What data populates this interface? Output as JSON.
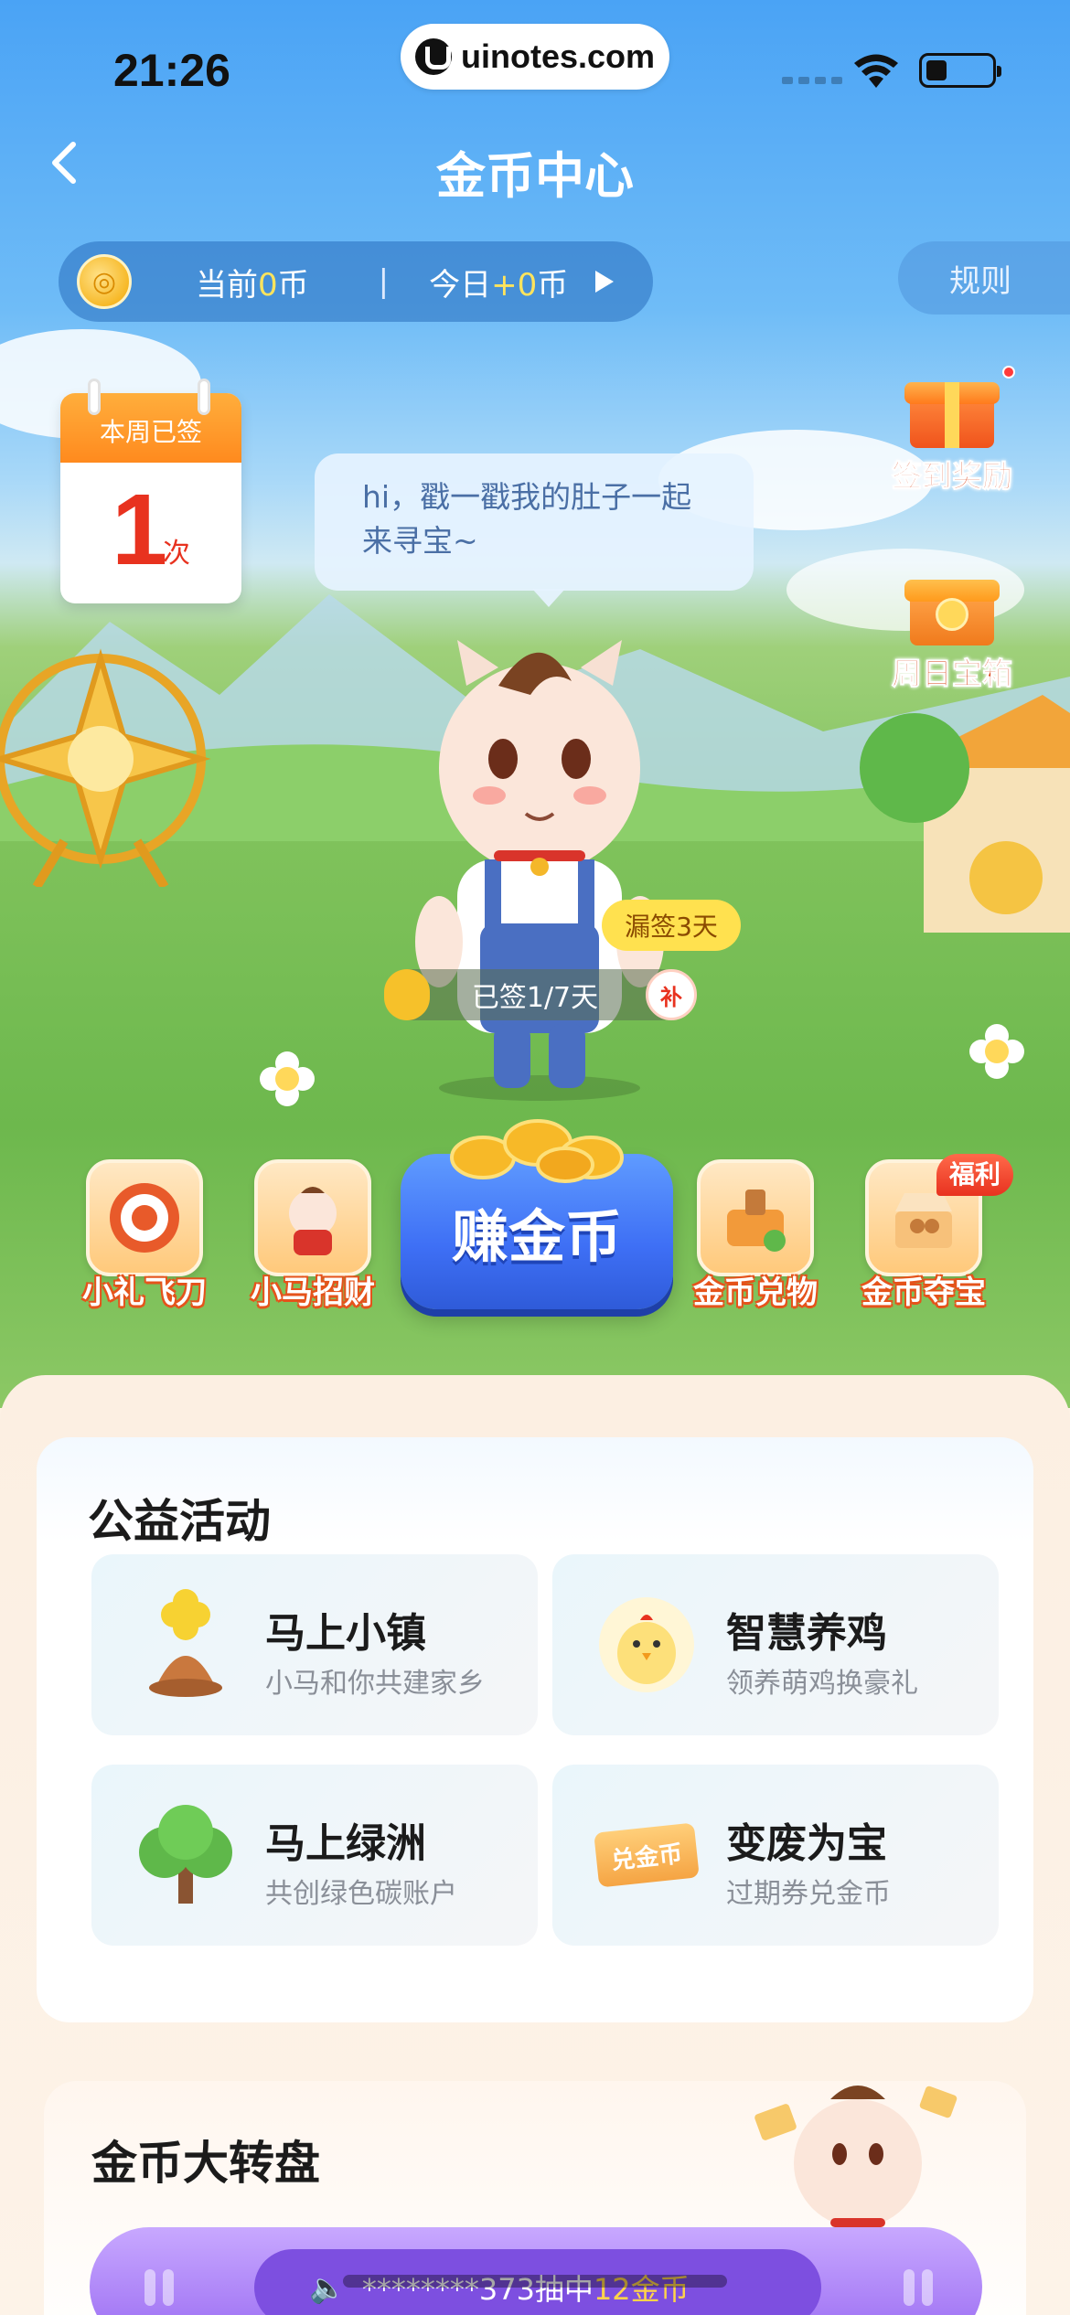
{
  "status_bar": {
    "time": "21:26",
    "url": "uinotes.com"
  },
  "header": {
    "title": "金币中心"
  },
  "coin_bar": {
    "current_prefix": "当前",
    "current_value": "0",
    "current_suffix": "币",
    "separator": "|",
    "today_prefix": "今日",
    "today_value": "+0",
    "today_suffix": "币"
  },
  "rules_label": "规则",
  "calendar": {
    "header": "本周已签",
    "count": "1",
    "unit": "次"
  },
  "speech": "hi，戳一戳我的肚子一起来寻宝~",
  "side_buttons": [
    {
      "label": "签到奖励"
    },
    {
      "label": "周日宝箱"
    }
  ],
  "sign_in": {
    "missed": "漏签3天",
    "progress": "已签1/7天",
    "makeup": "补"
  },
  "activities": [
    {
      "label": "小礼飞刀"
    },
    {
      "label": "小马招财"
    },
    {
      "label": "金币兑物"
    },
    {
      "label": "金币夺宝",
      "tag": "福利"
    }
  ],
  "earn_button": {
    "label": "赚金币"
  },
  "charity": {
    "title": "公益活动",
    "tiles": [
      {
        "name": "马上小镇",
        "sub": "小马和你共建家乡"
      },
      {
        "name": "智慧养鸡",
        "sub": "领养萌鸡换豪礼"
      },
      {
        "name": "马上绿洲",
        "sub": "共创绿色碳账户"
      },
      {
        "name": "变废为宝",
        "sub": "过期券兑金币",
        "icon_text": "兑金币"
      }
    ]
  },
  "wheel": {
    "title": "金币大转盘",
    "ticker_prefix": "********373抽中",
    "ticker_value": "12金币"
  },
  "colors": {
    "accent_blue": "#3e6ff5",
    "accent_orange": "#e5531b",
    "highlight_yellow": "#ffe45c"
  }
}
